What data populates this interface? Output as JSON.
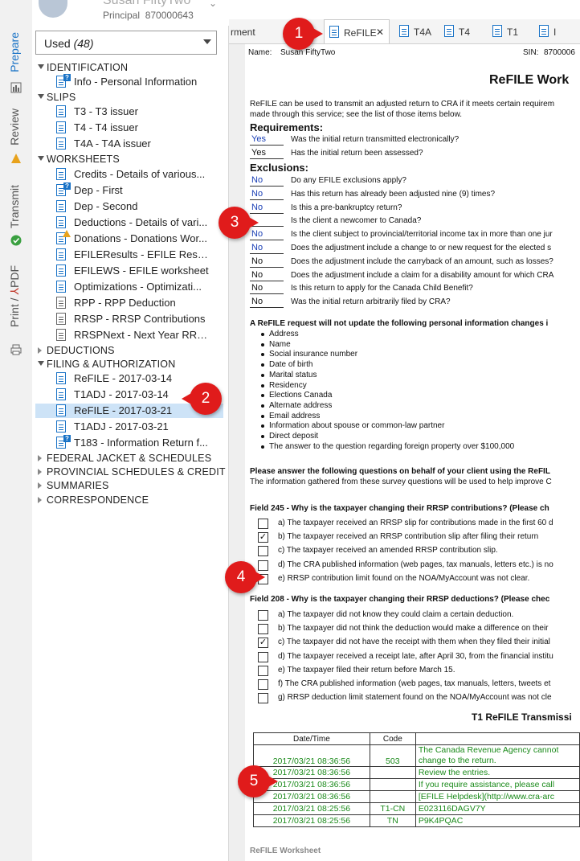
{
  "client": {
    "name": "Susan FiftyTwo",
    "role": "Principal",
    "id": "870000643"
  },
  "side_tabs": {
    "prepare": "Prepare",
    "review": "Review",
    "transmit": "Transmit",
    "print": "Print / ",
    "pdf": "PDF"
  },
  "filter": {
    "label": "Used",
    "count": "(48)"
  },
  "tree": [
    {
      "type": "cat",
      "label": "IDENTIFICATION",
      "open": true
    },
    {
      "type": "item",
      "label": "Info - Personal Information",
      "icon": "doc-info-icon"
    },
    {
      "type": "cat",
      "label": "SLIPS",
      "open": true
    },
    {
      "type": "item",
      "label": "T3 - T3 issuer",
      "icon": "doc-icon"
    },
    {
      "type": "item",
      "label": "T4 - T4 issuer",
      "icon": "doc-icon"
    },
    {
      "type": "item",
      "label": "T4A - T4A issuer",
      "icon": "doc-icon"
    },
    {
      "type": "cat",
      "label": "WORKSHEETS",
      "open": true
    },
    {
      "type": "item",
      "label": "Credits - Details of various...",
      "icon": "doc-icon"
    },
    {
      "type": "item",
      "label": "Dep - First",
      "icon": "doc-info-icon"
    },
    {
      "type": "item",
      "label": "Dep - Second",
      "icon": "doc-icon"
    },
    {
      "type": "item",
      "label": "Deductions - Details of vari...",
      "icon": "doc-icon"
    },
    {
      "type": "item",
      "label": "Donations - Donations Wor...",
      "icon": "doc-warning-icon"
    },
    {
      "type": "item",
      "label": "EFILEResults - EFILE Results",
      "icon": "doc-icon"
    },
    {
      "type": "item",
      "label": "EFILEWS - EFILE worksheet",
      "icon": "doc-icon"
    },
    {
      "type": "item",
      "label": "Optimizations - Optimizati...",
      "icon": "doc-icon"
    },
    {
      "type": "item",
      "label": "RPP - RPP Deduction",
      "icon": "doc-gray-icon"
    },
    {
      "type": "item",
      "label": "RRSP - RRSP Contributions",
      "icon": "doc-gray-icon"
    },
    {
      "type": "item",
      "label": "RRSPNext - Next Year RRSP...",
      "icon": "doc-gray-icon"
    },
    {
      "type": "cat",
      "label": "DEDUCTIONS",
      "open": false
    },
    {
      "type": "cat",
      "label": "FILING & AUTHORIZATION",
      "open": true
    },
    {
      "type": "item",
      "label": "ReFILE - 2017-03-14",
      "icon": "doc-icon"
    },
    {
      "type": "item",
      "label": "T1ADJ - 2017-03-14",
      "icon": "doc-icon"
    },
    {
      "type": "item",
      "label": "ReFILE - 2017-03-21",
      "icon": "doc-icon",
      "selected": true
    },
    {
      "type": "item",
      "label": "T1ADJ - 2017-03-21",
      "icon": "doc-icon"
    },
    {
      "type": "item",
      "label": "T183 - Information Return f...",
      "icon": "doc-info-icon"
    },
    {
      "type": "cat",
      "label": "FEDERAL JACKET & SCHEDULES",
      "open": false
    },
    {
      "type": "cat",
      "label": "PROVINCIAL SCHEDULES & CREDIT",
      "open": false
    },
    {
      "type": "cat",
      "label": "SUMMARIES",
      "open": false
    },
    {
      "type": "cat",
      "label": "CORRESPONDENCE",
      "open": false
    }
  ],
  "tabs": [
    {
      "label": "rment",
      "active": false
    },
    {
      "label": "ReFILE",
      "active": true
    },
    {
      "label": "T4A",
      "active": false
    },
    {
      "label": "T4",
      "active": false
    },
    {
      "label": "T1",
      "active": false
    },
    {
      "label": "I",
      "active": false
    }
  ],
  "doc": {
    "name_label": "Name:",
    "name_value": "Susan FiftyTwo",
    "sin_label": "SIN:",
    "sin_value": "8700006",
    "title": "ReFILE Work",
    "intro1": "ReFILE can be used to transmit an adjusted return to CRA if it meets certain requirem",
    "intro2": "made through this service; see the list of those items below.",
    "req_heading": "Requirements:",
    "requirements": [
      {
        "answer": "Yes",
        "blue": true,
        "text": "Was the initial return transmitted electronically?"
      },
      {
        "answer": "Yes",
        "blue": false,
        "text": "Has the initial return been assessed?"
      }
    ],
    "excl_heading": "Exclusions:",
    "exclusions": [
      {
        "answer": "No",
        "blue": true,
        "text": "Do any EFILE exclusions apply?"
      },
      {
        "answer": "No",
        "blue": true,
        "text": "Has this return has already been adjusted nine (9) times?"
      },
      {
        "answer": "No",
        "blue": true,
        "text": "Is this a pre-bankruptcy return?"
      },
      {
        "answer": "",
        "blue": true,
        "text": "Is the client a newcomer to Canada?"
      },
      {
        "answer": "No",
        "blue": true,
        "text": "Is the client subject to provincial/territorial income tax in more than one jur"
      },
      {
        "answer": "No",
        "blue": true,
        "text": "Does the adjustment include a change to or new request for the elected s"
      },
      {
        "answer": "No",
        "blue": false,
        "text": "Does the adjustment include the carryback of an amount, such as losses?"
      },
      {
        "answer": "No",
        "blue": false,
        "text": "Does the adjustment include a claim for a disability amount for which CRA"
      },
      {
        "answer": "No",
        "blue": false,
        "text": "Is this return to apply for the Canada Child Benefit?"
      },
      {
        "answer": "No",
        "blue": false,
        "text": "Was the initial return arbitrarily filed by CRA?"
      }
    ],
    "update_heading": "A ReFILE request will not update the following personal information changes i",
    "bullets": [
      "Address",
      "Name",
      "Social insurance number",
      "Date of birth",
      "Marital status",
      "Residency",
      "Elections Canada",
      "Alternate address",
      "Email address",
      "Information about spouse or common-law partner",
      "Direct deposit",
      "The answer to the question regarding foreign property over $100,000"
    ],
    "survey1": "Please answer the following questions on behalf of your client using the ReFIL",
    "survey2": "The information gathered from these survey questions will be used to help improve C",
    "field245_heading": "Field 245 - Why is the taxpayer changing their RRSP contributions? (Please ch",
    "field245": [
      {
        "checked": false,
        "text": "a) The taxpayer received an RRSP slip for contributions made in the first 60 d"
      },
      {
        "checked": true,
        "text": "b) The taxpayer received an RRSP contribution slip after filing their return"
      },
      {
        "checked": false,
        "text": "c) The taxpayer received an amended RRSP contribution slip."
      },
      {
        "checked": false,
        "text": "d) The CRA published information (web pages, tax manuals, letters etc.) is no"
      },
      {
        "checked": false,
        "text": "e) RRSP contribution limit found on the NOA/MyAccount was not clear."
      }
    ],
    "field208_heading": "Field 208 - Why is the taxpayer changing their RRSP deductions? (Please chec",
    "field208": [
      {
        "checked": false,
        "text": "a) The taxpayer did not know they could claim a certain deduction."
      },
      {
        "checked": false,
        "text": "b) The taxpayer did not think the deduction would make a difference on their"
      },
      {
        "checked": true,
        "text": "c) The taxpayer did not have the receipt with them when they filed their initial"
      },
      {
        "checked": false,
        "text": "d) The taxpayer received a receipt late, after April 30, from the financial institu"
      },
      {
        "checked": false,
        "text": "e) The taxpayer filed their return before March 15."
      },
      {
        "checked": false,
        "text": "f) The CRA published information (web pages, tax manuals, letters, tweets et"
      },
      {
        "checked": false,
        "text": "g) RRSP deduction limit statement found on the NOA/MyAccount was not cle"
      }
    ],
    "transmission_title": "T1 ReFILE Transmissi",
    "log_headers": [
      "Date/Time",
      "Code",
      ""
    ],
    "log_rows": [
      {
        "dt": "2017/03/21 08:36:56",
        "code": "503",
        "msg": "The Canada Revenue Agency cannot change to the return.",
        "tall": true
      },
      {
        "dt": "2017/03/21 08:36:56",
        "code": "",
        "msg": "Review the entries."
      },
      {
        "dt": "2017/03/21 08:36:56",
        "code": "",
        "msg": "If you require assistance, please call"
      },
      {
        "dt": "2017/03/21 08:36:56",
        "code": "",
        "msg": "[EFILE Helpdesk](http://www.cra-arc"
      },
      {
        "dt": "2017/03/21 08:25:56",
        "code": "T1-CN",
        "msg": "E023116DAGV7Y"
      },
      {
        "dt": "2017/03/21 08:25:56",
        "code": "TN",
        "msg": "P9K4PQAC"
      }
    ],
    "footer": "ReFILE Worksheet"
  },
  "callouts": [
    "1",
    "2",
    "3",
    "4",
    "5"
  ],
  "colors": {
    "accent": "#1a73c6",
    "callout": "#e01b1b",
    "selected": "#cde3f7",
    "log_text": "#1a8a1a",
    "answer_blue": "#1a3fb5"
  }
}
